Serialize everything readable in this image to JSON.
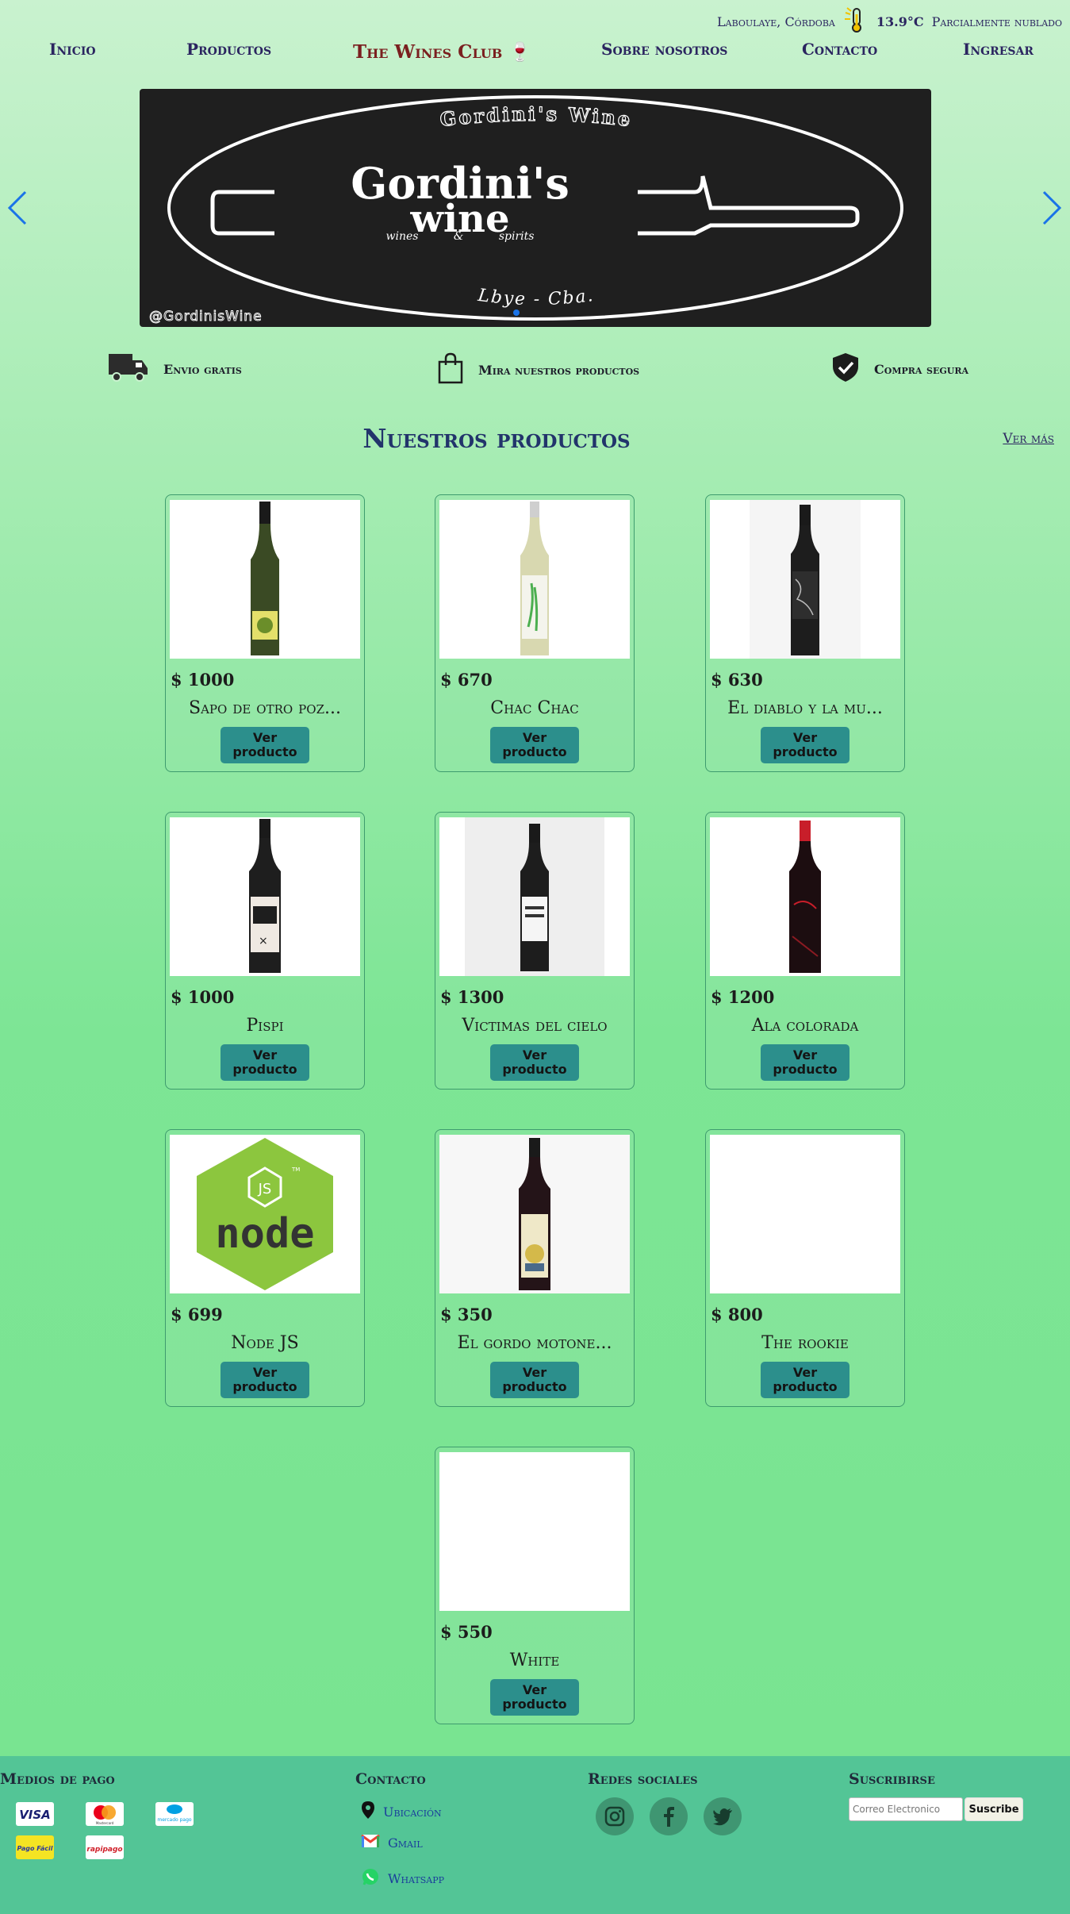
{
  "weather": {
    "location": "Laboulaye, Córdoba",
    "temperature": "13.9°C",
    "condition": "Parcialmente nublado",
    "icon": "thermometer-sun-icon"
  },
  "nav": {
    "items": [
      "Inicio",
      "Productos",
      "The Wines Club 🍷",
      "Sobre nosotros",
      "Contacto",
      "Ingresar"
    ]
  },
  "banner": {
    "arc_top": "Gordini's Wine",
    "title_line1": "Gordini's",
    "title_line2": "wine",
    "tagline": "wines & spirits",
    "arc_bottom": "Lbye - Cba.",
    "handle": "@GordinisWine",
    "slides_total": 1,
    "active_slide": 1
  },
  "features": [
    {
      "label": "Envio gratis",
      "icon": "truck-icon"
    },
    {
      "label": "Mira nuestros productos",
      "icon": "shopping-bag-icon"
    },
    {
      "label": "Compra segura",
      "icon": "shield-check-icon"
    }
  ],
  "products_section": {
    "title": "Nuestros productos",
    "see_more": "Ver más"
  },
  "products": [
    {
      "price": "$ 1000",
      "name": "Sapo de otro poz...",
      "button": "Ver producto",
      "image": "sparkling-bottle"
    },
    {
      "price": "$ 670",
      "name": "Chac Chac",
      "button": "Ver producto",
      "image": "white-wine-bottle"
    },
    {
      "price": "$ 630",
      "name": "El diablo y la mu...",
      "button": "Ver producto",
      "image": "dark-label-bottle"
    },
    {
      "price": "$ 1000",
      "name": "Pispi",
      "button": "Ver producto",
      "image": "pispi-bottle"
    },
    {
      "price": "$ 1300",
      "name": "Victimas del cielo",
      "button": "Ver producto",
      "image": "victimas-bottle"
    },
    {
      "price": "$ 1200",
      "name": "Ala colorada",
      "button": "Ver producto",
      "image": "red-cap-bottle"
    },
    {
      "price": "$ 699",
      "name": "Node JS",
      "button": "Ver producto",
      "image": "nodejs-logo"
    },
    {
      "price": "$ 350",
      "name": "El gordo motone...",
      "button": "Ver producto",
      "image": "gordo-bottle"
    },
    {
      "price": "$ 800",
      "name": "The rookie",
      "button": "Ver producto",
      "image": "blank"
    },
    {
      "price": "$ 550",
      "name": "White",
      "button": "Ver producto",
      "image": "blank"
    }
  ],
  "nodejs_logo": {
    "js": "JS",
    "word": "node",
    "tm": "TM"
  },
  "footer": {
    "payment_title": "Medios de pago",
    "payment_methods": [
      "VISA",
      "Mastercard",
      "mercado pago",
      "Pago Fácil",
      "rapipago"
    ],
    "contact_title": "Contacto",
    "contact_items": [
      {
        "label": "Ubicación",
        "icon": "map-pin-icon"
      },
      {
        "label": "Gmail",
        "icon": "gmail-icon"
      },
      {
        "label": "Whatsapp",
        "icon": "whatsapp-icon"
      }
    ],
    "social_title": "Redes sociales",
    "social": [
      "instagram-icon",
      "facebook-icon",
      "twitter-icon"
    ],
    "subscribe_title": "Suscribirse",
    "email_placeholder": "Correo Electronico",
    "subscribe_button": "Suscribe"
  },
  "colors": {
    "nav_text": "#2b2560",
    "brand": "#7a1f1f",
    "button": "#2c8f8c",
    "footer_bg": "#53c596",
    "social_bg": "#3f9672",
    "carousel_arrow": "#1a73e8"
  }
}
